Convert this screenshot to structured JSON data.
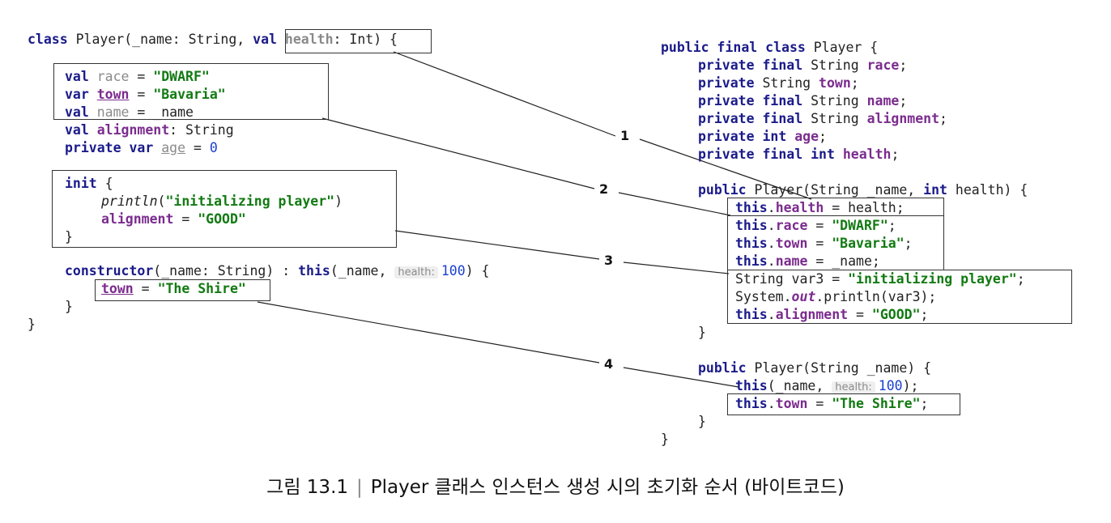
{
  "kotlin": {
    "l1": {
      "kw": "class",
      "plain1": " Player(_name: String, ",
      "kw2": "val",
      "sp": " ",
      "health": "health",
      "rest": ": Int",
      "close": ") {"
    },
    "l2": {
      "kw": "val",
      "name": " race",
      "eq": " = ",
      "str": "\"DWARF\""
    },
    "l3": {
      "kw": "var",
      "sp": " ",
      "name": "town",
      "eq": " = ",
      "str": "\"Bavaria\""
    },
    "l4": {
      "kw": "val",
      "sp": " ",
      "name": "name",
      "rest": " = _name"
    },
    "l5": {
      "kw": "val",
      "name": " alignment",
      "rest": ": String"
    },
    "l6": {
      "kw": "private var",
      "sp": " ",
      "name": "age",
      "eq": " = ",
      "num": "0"
    },
    "l7": {
      "kw": "init",
      "rest": " {"
    },
    "l8": {
      "fn": "println",
      "open": "(",
      "str": "\"initializing player\"",
      "close": ")"
    },
    "l9": {
      "name": "alignment",
      "eq": " = ",
      "str": "\"GOOD\""
    },
    "l10": "}",
    "l11": {
      "kw": "constructor",
      "mid": "(_name: String) : ",
      "kw2": "this",
      "rest": "(_name, ",
      "hint": "health:",
      "num": "100",
      "close": ") {"
    },
    "l12": {
      "name": "town",
      "eq": " = ",
      "str": "\"The Shire\""
    },
    "l13": "}",
    "l14": "}"
  },
  "java": {
    "j1": {
      "kw": "public final class",
      "rest": " Player {"
    },
    "j2": {
      "kw": "private final",
      "type": " String ",
      "name": "race",
      "semi": ";"
    },
    "j3": {
      "kw": "private",
      "type": " String ",
      "name": "town",
      "semi": ";"
    },
    "j4": {
      "kw": "private final",
      "type": " String ",
      "name": "name",
      "semi": ";"
    },
    "j5": {
      "kw": "private final",
      "type": " String ",
      "name": "alignment",
      "semi": ";"
    },
    "j6": {
      "kw": "private int",
      "sp": " ",
      "name": "age",
      "semi": ";"
    },
    "j7": {
      "kw": "private final int",
      "sp": " ",
      "name": "health",
      "semi": ";"
    },
    "j8": {
      "kw": "public",
      "mid": " Player(String _name, ",
      "kw2": "int",
      "rest": " health) {"
    },
    "j9": {
      "kw": "this",
      "dot": ".",
      "name": "health",
      "rest": " = health;"
    },
    "j10": {
      "kw": "this",
      "dot": ".",
      "name": "race",
      "eq": " = ",
      "str": "\"DWARF\"",
      "semi": ";"
    },
    "j11": {
      "kw": "this",
      "dot": ".",
      "name": "town",
      "eq": " = ",
      "str": "\"Bavaria\"",
      "semi": ";"
    },
    "j12": {
      "kw": "this",
      "dot": ".",
      "name": "name",
      "rest": " = _name;"
    },
    "j13": {
      "pre": "String var3 = ",
      "str": "\"initializing player\"",
      "semi": ";"
    },
    "j14": {
      "pre": "System.",
      "out": "out",
      "rest": ".println(var3);"
    },
    "j15": {
      "kw": "this",
      "dot": ".",
      "name": "alignment",
      "eq": " = ",
      "str": "\"GOOD\"",
      "semi": ";"
    },
    "j16": "}",
    "j17": {
      "kw": "public",
      "rest": " Player(String _name) {"
    },
    "j18": {
      "kw": "this",
      "rest": "(_name, ",
      "hint": "health:",
      "num": "100",
      "close": ");"
    },
    "j19": {
      "kw": "this",
      "dot": ".",
      "name": "town",
      "eq": " = ",
      "str": "\"The Shire\"",
      "semi": ";"
    },
    "j20": "}",
    "j21": "}"
  },
  "labels": [
    "1",
    "2",
    "3",
    "4"
  ],
  "caption": {
    "fig": "그림 13.1",
    "sep": "|",
    "text": "Player 클래스 인스턴스 생성 시의 초기화 순서 (바이트코드)"
  }
}
